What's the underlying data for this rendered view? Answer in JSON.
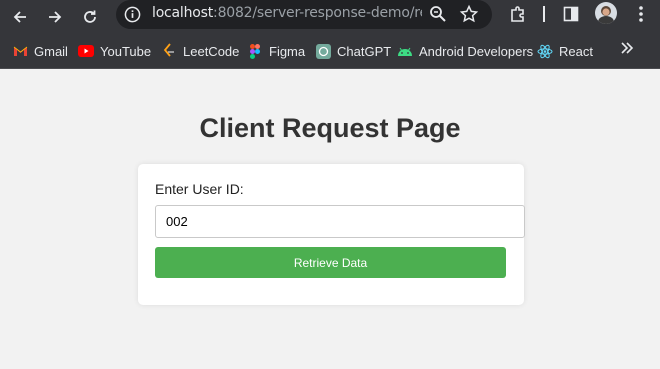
{
  "browser": {
    "url_host": "localhost",
    "url_rest": ":8082/server-response-demo/requ...",
    "bookmarks": [
      {
        "label": "Gmail",
        "icon": "gmail-icon"
      },
      {
        "label": "YouTube",
        "icon": "youtube-icon"
      },
      {
        "label": "LeetCode",
        "icon": "leetcode-icon"
      },
      {
        "label": "Figma",
        "icon": "figma-icon"
      },
      {
        "label": "ChatGPT",
        "icon": "chatgpt-icon"
      },
      {
        "label": "Android Developers",
        "icon": "android-icon"
      },
      {
        "label": "React",
        "icon": "react-icon"
      }
    ]
  },
  "page": {
    "title": "Client Request Page",
    "form": {
      "label": "Enter User ID:",
      "input_value": "002",
      "button_label": "Retrieve Data"
    }
  },
  "colors": {
    "button": "#4caf50",
    "background": "#f2f2f2",
    "chrome": "#35363a"
  }
}
